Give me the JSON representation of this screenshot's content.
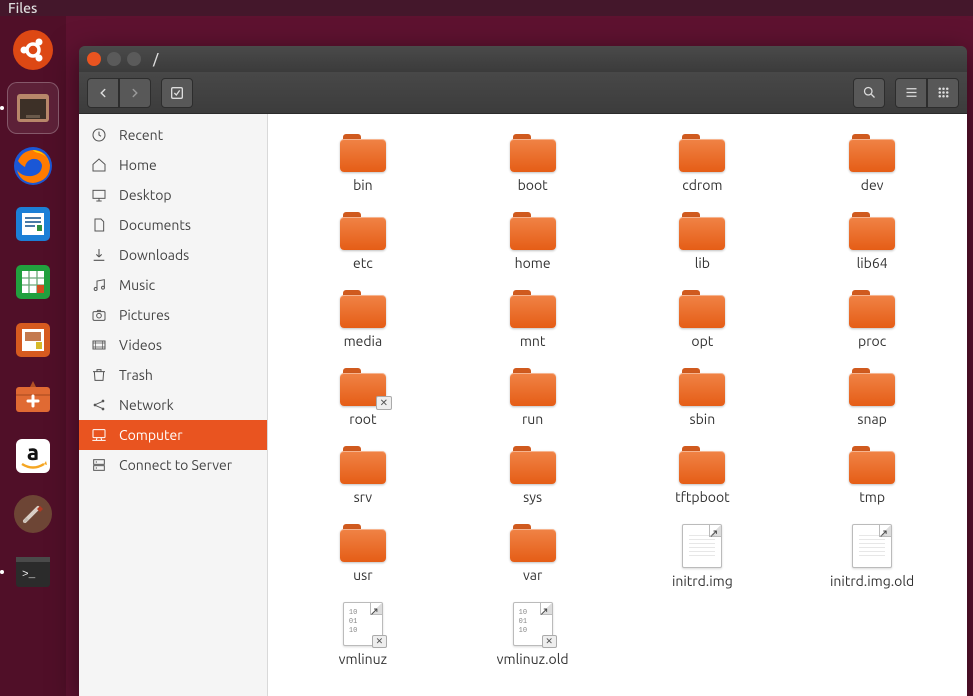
{
  "menubar": {
    "title": "Files"
  },
  "window": {
    "path": "/"
  },
  "sidebar": [
    {
      "icon": "clock-icon",
      "label": "Recent",
      "selected": false
    },
    {
      "icon": "home-icon",
      "label": "Home",
      "selected": false
    },
    {
      "icon": "desktop-icon",
      "label": "Desktop",
      "selected": false
    },
    {
      "icon": "document-icon",
      "label": "Documents",
      "selected": false
    },
    {
      "icon": "download-icon",
      "label": "Downloads",
      "selected": false
    },
    {
      "icon": "music-icon",
      "label": "Music",
      "selected": false
    },
    {
      "icon": "camera-icon",
      "label": "Pictures",
      "selected": false
    },
    {
      "icon": "video-icon",
      "label": "Videos",
      "selected": false
    },
    {
      "icon": "trash-icon",
      "label": "Trash",
      "selected": false
    },
    {
      "icon": "network-icon",
      "label": "Network",
      "selected": false
    },
    {
      "icon": "computer-icon",
      "label": "Computer",
      "selected": true
    },
    {
      "icon": "server-icon",
      "label": "Connect to Server",
      "selected": false
    }
  ],
  "items": [
    {
      "name": "bin",
      "type": "folder"
    },
    {
      "name": "boot",
      "type": "folder"
    },
    {
      "name": "cdrom",
      "type": "folder"
    },
    {
      "name": "dev",
      "type": "folder"
    },
    {
      "name": "etc",
      "type": "folder"
    },
    {
      "name": "home",
      "type": "folder"
    },
    {
      "name": "lib",
      "type": "folder"
    },
    {
      "name": "lib64",
      "type": "folder"
    },
    {
      "name": "media",
      "type": "folder"
    },
    {
      "name": "mnt",
      "type": "folder"
    },
    {
      "name": "opt",
      "type": "folder"
    },
    {
      "name": "proc",
      "type": "folder"
    },
    {
      "name": "root",
      "type": "folder",
      "locked": true
    },
    {
      "name": "run",
      "type": "folder"
    },
    {
      "name": "sbin",
      "type": "folder"
    },
    {
      "name": "snap",
      "type": "folder"
    },
    {
      "name": "srv",
      "type": "folder"
    },
    {
      "name": "sys",
      "type": "folder"
    },
    {
      "name": "tftpboot",
      "type": "folder"
    },
    {
      "name": "tmp",
      "type": "folder"
    },
    {
      "name": "usr",
      "type": "folder"
    },
    {
      "name": "var",
      "type": "folder"
    },
    {
      "name": "initrd.img",
      "type": "file-text"
    },
    {
      "name": "initrd.img.old",
      "type": "file-text"
    },
    {
      "name": "vmlinuz",
      "type": "file-bin",
      "locked": true
    },
    {
      "name": "vmlinuz.old",
      "type": "file-bin",
      "locked": true
    }
  ],
  "launcher": [
    {
      "name": "dash",
      "active": false,
      "pip": false
    },
    {
      "name": "files",
      "active": true,
      "pip": true
    },
    {
      "name": "firefox",
      "active": false,
      "pip": false
    },
    {
      "name": "writer",
      "active": false,
      "pip": false
    },
    {
      "name": "calc",
      "active": false,
      "pip": false
    },
    {
      "name": "impress",
      "active": false,
      "pip": false
    },
    {
      "name": "software",
      "active": false,
      "pip": false
    },
    {
      "name": "amazon",
      "active": false,
      "pip": false
    },
    {
      "name": "settings",
      "active": false,
      "pip": false
    },
    {
      "name": "terminal",
      "active": false,
      "pip": true
    }
  ]
}
